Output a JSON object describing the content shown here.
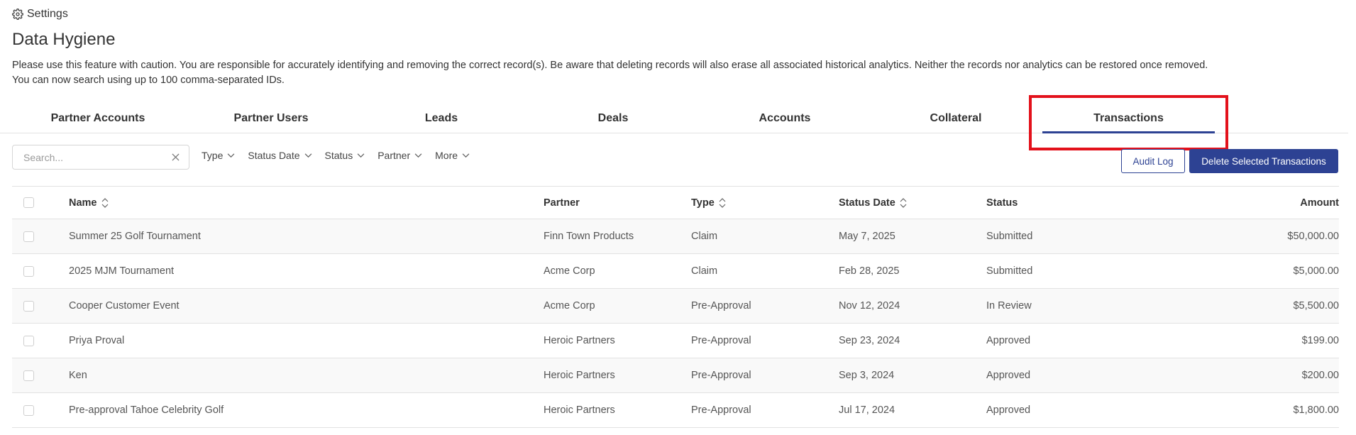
{
  "breadcrumb": {
    "icon": "gear-icon",
    "label": "Settings"
  },
  "page_title": "Data Hygiene",
  "notice": {
    "line1": "Please use this feature with caution. You are responsible for accurately identifying and removing the correct record(s). Be aware that deleting records will also erase all associated historical analytics. Neither the records nor analytics can be restored once removed.",
    "line2": "You can now search using up to 100 comma-separated IDs."
  },
  "tabs": [
    {
      "label": "Partner Accounts",
      "active": false
    },
    {
      "label": "Partner Users",
      "active": false
    },
    {
      "label": "Leads",
      "active": false
    },
    {
      "label": "Deals",
      "active": false
    },
    {
      "label": "Accounts",
      "active": false
    },
    {
      "label": "Collateral",
      "active": false
    },
    {
      "label": "Transactions",
      "active": true
    }
  ],
  "highlight_color": "#e3111b",
  "accent_color": "#2d4293",
  "search": {
    "placeholder": "Search...",
    "value": ""
  },
  "filters": [
    "Type",
    "Status Date",
    "Status",
    "Partner",
    "More"
  ],
  "buttons": {
    "audit_log": "Audit Log",
    "delete_selected": "Delete Selected Transactions"
  },
  "table": {
    "headers": {
      "name": "Name",
      "partner": "Partner",
      "type": "Type",
      "status_date": "Status Date",
      "status": "Status",
      "amount": "Amount"
    },
    "rows": [
      {
        "name": "Summer 25 Golf Tournament",
        "partner": "Finn Town Products",
        "type": "Claim",
        "status_date": "May 7, 2025",
        "status": "Submitted",
        "amount": "$50,000.00"
      },
      {
        "name": "2025 MJM Tournament",
        "partner": "Acme Corp",
        "type": "Claim",
        "status_date": "Feb 28, 2025",
        "status": "Submitted",
        "amount": "$5,000.00"
      },
      {
        "name": "Cooper Customer Event",
        "partner": "Acme Corp",
        "type": "Pre-Approval",
        "status_date": "Nov 12, 2024",
        "status": "In Review",
        "amount": "$5,500.00"
      },
      {
        "name": "Priya Proval",
        "partner": "Heroic Partners",
        "type": "Pre-Approval",
        "status_date": "Sep 23, 2024",
        "status": "Approved",
        "amount": "$199.00"
      },
      {
        "name": "Ken",
        "partner": "Heroic Partners",
        "type": "Pre-Approval",
        "status_date": "Sep 3, 2024",
        "status": "Approved",
        "amount": "$200.00"
      },
      {
        "name": "Pre-approval Tahoe Celebrity Golf",
        "partner": "Heroic Partners",
        "type": "Pre-Approval",
        "status_date": "Jul 17, 2024",
        "status": "Approved",
        "amount": "$1,800.00"
      }
    ]
  }
}
